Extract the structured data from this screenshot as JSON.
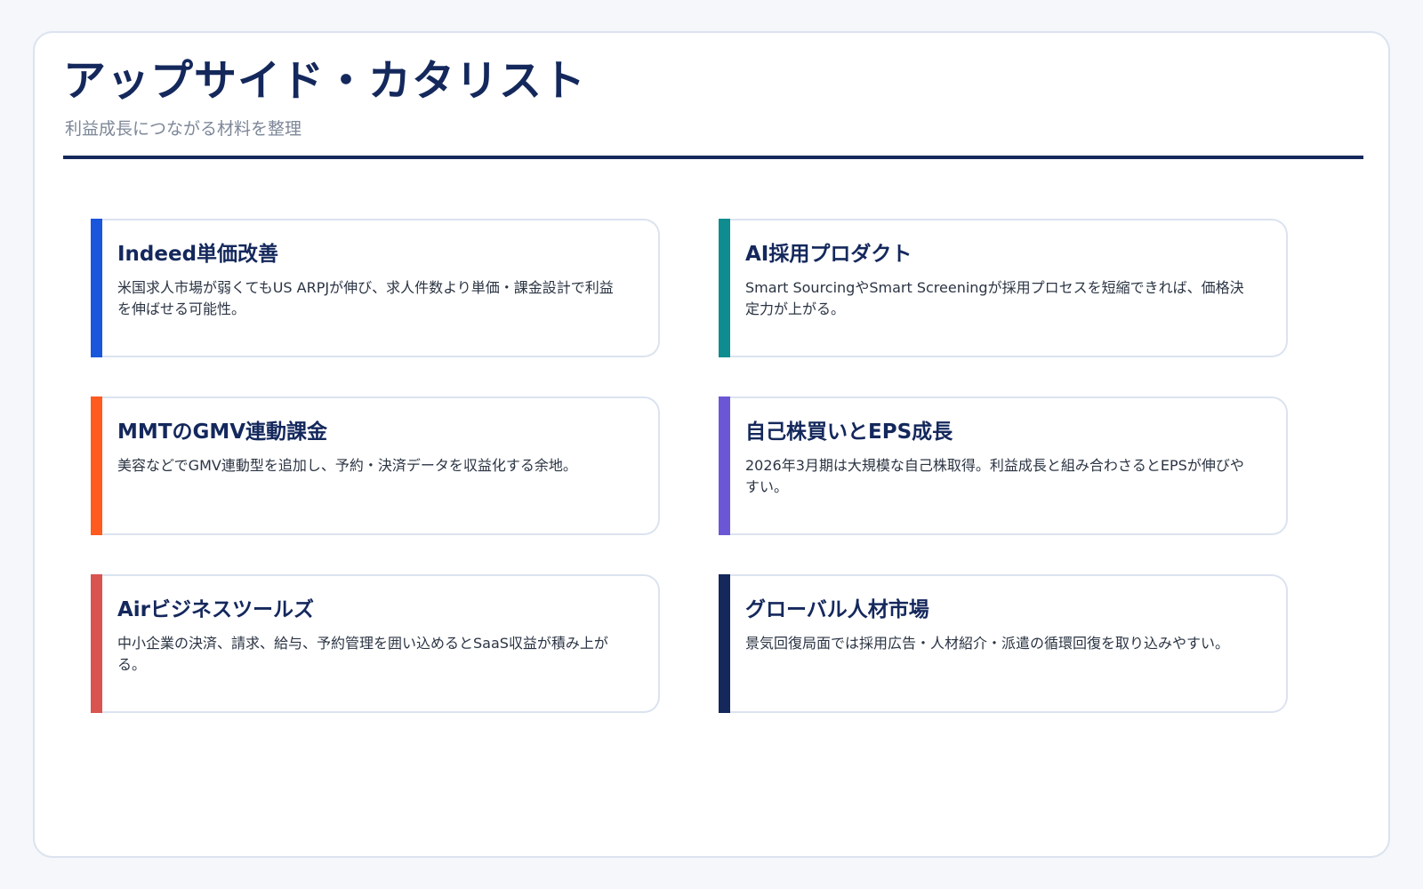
{
  "page": {
    "title": "アップサイド・カタリスト",
    "subtitle": "利益成長につながる材料を整理"
  },
  "cards": [
    {
      "title": "Indeed単価改善",
      "text": "米国求人市場が弱くてもUS ARPJが伸び、求人件数より単価・課金設計で利益を伸ばせる可能性。",
      "accent": "#1a56db"
    },
    {
      "title": "AI採用プロダクト",
      "text": "Smart SourcingやSmart Screeningが採用プロセスを短縮できれば、価格決定力が上がる。",
      "accent": "#0e8c8f"
    },
    {
      "title": "MMTのGMV連動課金",
      "text": "美容などでGMV連動型を追加し、予約・決済データを収益化する余地。",
      "accent": "#ff5a1f"
    },
    {
      "title": "自己株買いとEPS成長",
      "text": "2026年3月期は大規模な自己株取得。利益成長と組み合わさるとEPSが伸びやすい。",
      "accent": "#6b57d6"
    },
    {
      "title": "Airビジネスツールズ",
      "text": "中小企業の決済、請求、給与、予約管理を囲い込めるとSaaS収益が積み上がる。",
      "accent": "#d9534f"
    },
    {
      "title": "グローバル人材市場",
      "text": "景気回復局面では採用広告・人材紹介・派遣の循環回復を取り込みやすい。",
      "accent": "#14285c"
    }
  ]
}
